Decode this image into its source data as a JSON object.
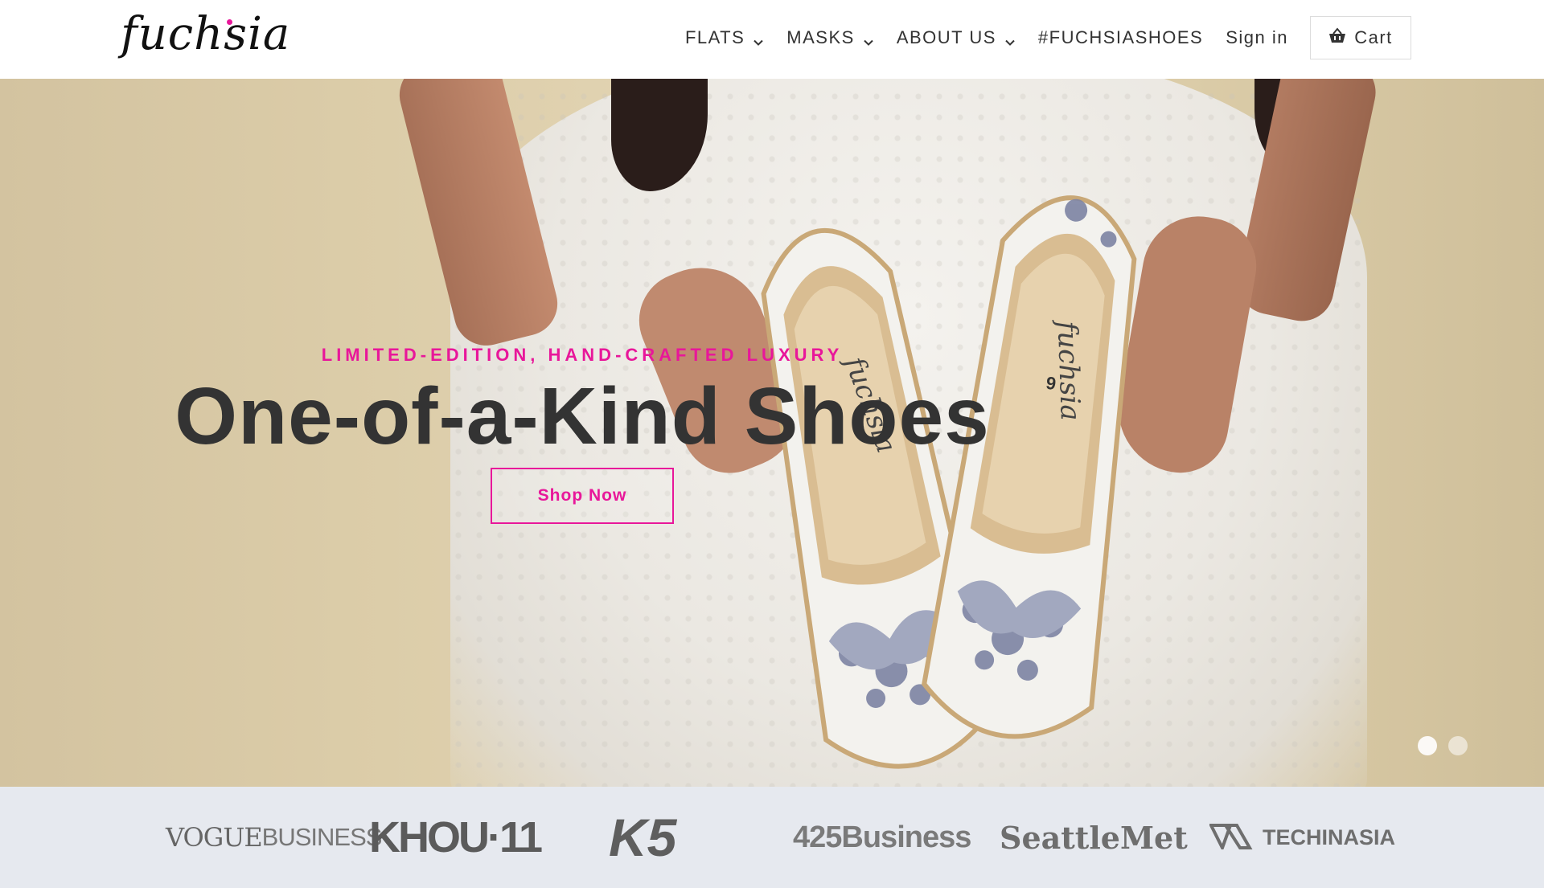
{
  "header": {
    "logo_text": "fuchsia",
    "nav": [
      {
        "label": "FLATS",
        "has_dropdown": true
      },
      {
        "label": "MASKS",
        "has_dropdown": true
      },
      {
        "label": "ABOUT US",
        "has_dropdown": true
      },
      {
        "label": "#FUCHSIASHOES",
        "has_dropdown": false
      },
      {
        "label": "Sign in",
        "has_dropdown": false
      }
    ],
    "cart_label": "Cart",
    "cart_icon": "basket-icon"
  },
  "hero": {
    "tagline": "LIMITED-EDITION, HAND-CRAFTED LUXURY",
    "headline": "One-of-a-Kind Shoes",
    "cta_label": "Shop Now",
    "slides_total": 2,
    "active_slide": 1,
    "shoe_brand_print": "fuchsia",
    "shoe_size_print": "9"
  },
  "press": {
    "logos": [
      {
        "name": "VOGUE",
        "suffix": "BUSINESS"
      },
      {
        "name": "KHOU",
        "suffix": "·11"
      },
      {
        "name": "K5",
        "suffix": ""
      },
      {
        "name": "425",
        "suffix": "Business"
      },
      {
        "name": "SeattleMet",
        "suffix": ""
      },
      {
        "name": "TECHINASIA",
        "suffix": ""
      }
    ]
  },
  "colors": {
    "accent": "#e8179a",
    "text_dark": "#333333",
    "press_bg": "#e6e9ef",
    "hero_bg": "#dccda9"
  }
}
